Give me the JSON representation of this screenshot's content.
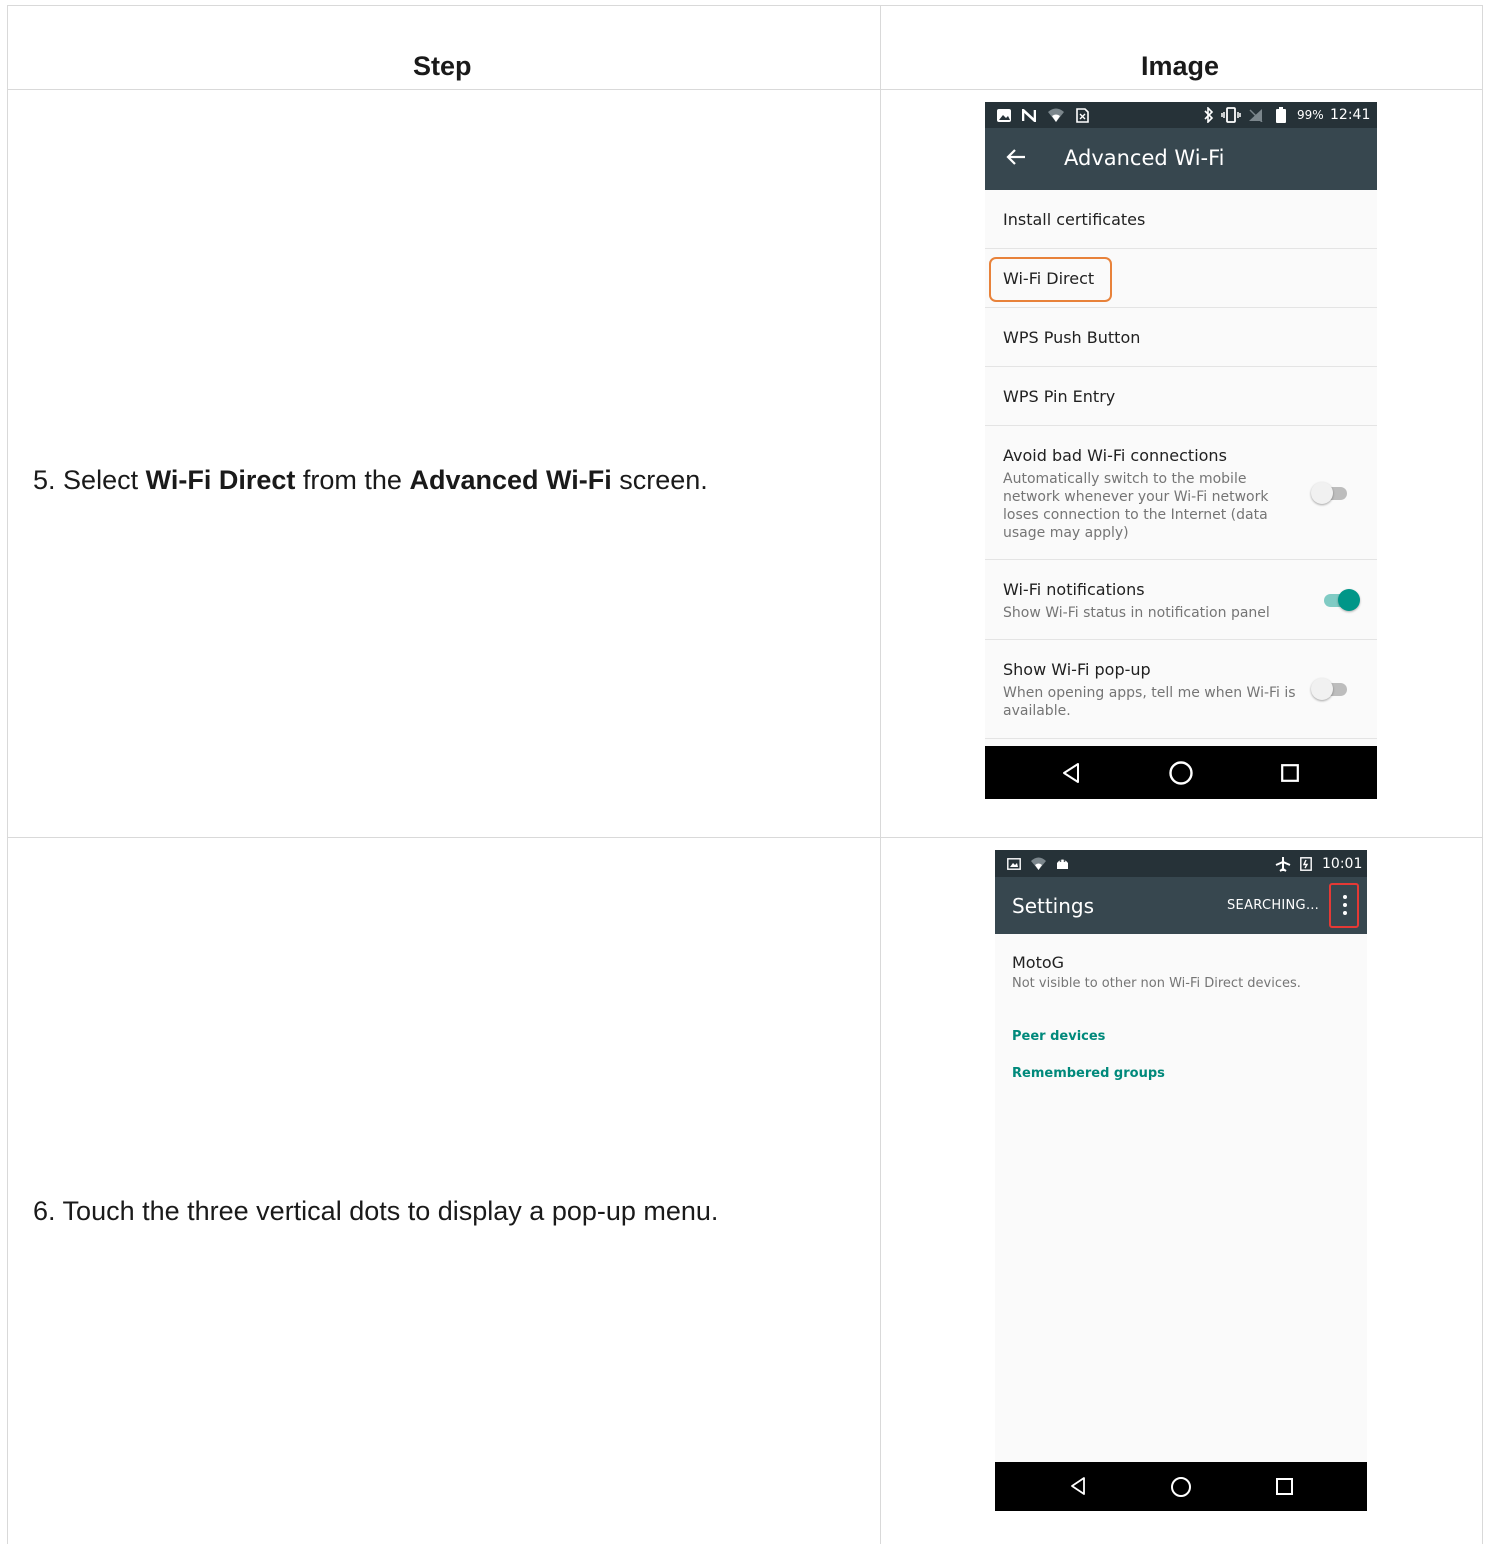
{
  "table": {
    "headers": {
      "step": "Step",
      "image": "Image"
    },
    "rows": [
      {
        "number": "5.",
        "parts": [
          {
            "text": "Select",
            "bold": false
          },
          {
            "text": "Wi-Fi Direct",
            "bold": true
          },
          {
            "text": "from the",
            "bold": false
          },
          {
            "text": "Advanced Wi-Fi",
            "bold": true
          },
          {
            "text": "screen.",
            "bold": false
          }
        ]
      },
      {
        "number": "6.",
        "text": "Touch the three vertical dots to display a pop-up menu."
      }
    ]
  },
  "screen1": {
    "status": {
      "battery": "99%",
      "time": "12:41"
    },
    "appbar_title": "Advanced Wi-Fi",
    "items": [
      {
        "label": "Install certificates"
      },
      {
        "label": "Wi-Fi Direct"
      },
      {
        "label": "WPS Push Button"
      },
      {
        "label": "WPS Pin Entry"
      },
      {
        "label": "Avoid bad Wi-Fi connections",
        "sub": [
          "Automatically switch to the mobile",
          "network whenever your Wi-Fi network",
          "loses connection to the Internet (data",
          "usage may apply)"
        ],
        "toggle": "off"
      },
      {
        "label": "Wi-Fi notifications",
        "sub": [
          "Show Wi-Fi status in notification panel"
        ],
        "toggle": "on"
      },
      {
        "label": "Show Wi-Fi pop-up",
        "sub": [
          "When opening apps, tell me when Wi-Fi is",
          "available."
        ],
        "toggle": "off"
      }
    ],
    "highlight_color": "#e8823a"
  },
  "screen2": {
    "status": {
      "time": "10:01"
    },
    "appbar_title": "Settings",
    "appbar_action": "SEARCHING…",
    "device": {
      "name": "MotoG",
      "sub": "Not visible to other non Wi-Fi Direct devices."
    },
    "sections": {
      "peer": "Peer devices",
      "remembered": "Remembered groups"
    },
    "accent_color": "#00897b",
    "highlight_color": "#e53935"
  }
}
